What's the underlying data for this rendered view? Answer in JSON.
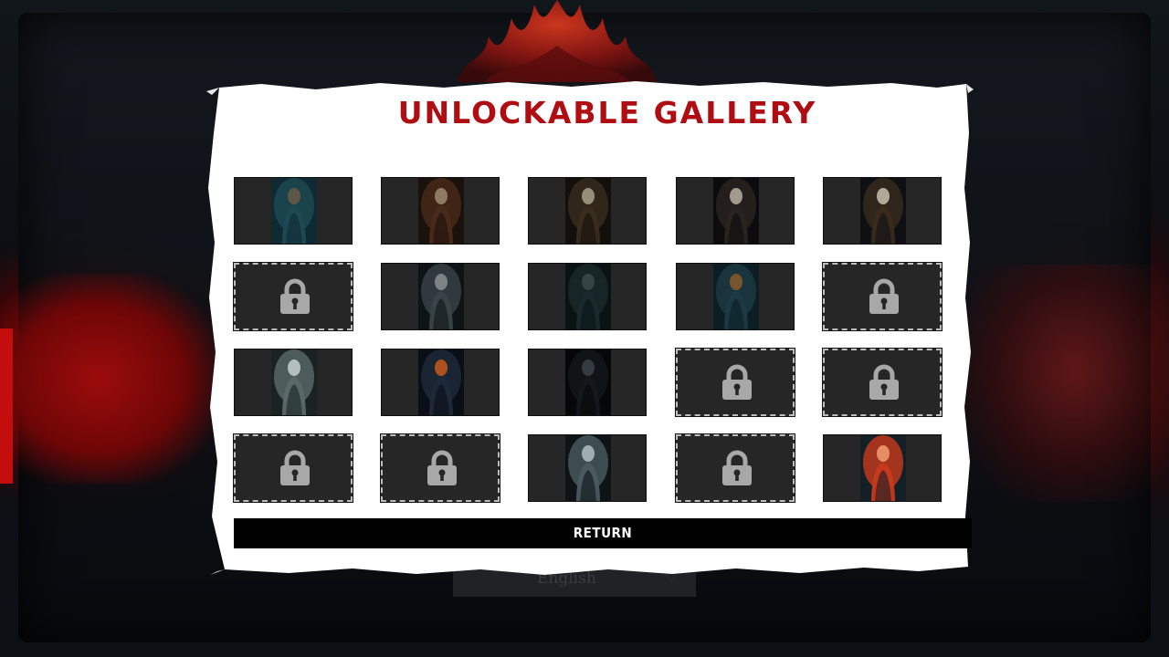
{
  "title": "UNLOCKABLE GALLERY",
  "return_label": "RETURN",
  "language": {
    "selected": "English",
    "chevron_icon": "chevron-down-icon"
  },
  "colors": {
    "title": "#b00d12",
    "tile_bg": "#262626",
    "return_bg": "#000000",
    "paper": "#ffffff"
  },
  "gallery": {
    "rows": 4,
    "columns": 5,
    "tiles": [
      {
        "state": "unlocked",
        "art": "masked-killer-teal"
      },
      {
        "state": "unlocked",
        "art": "masked-killer-rust"
      },
      {
        "state": "unlocked",
        "art": "masked-killer-brown"
      },
      {
        "state": "unlocked",
        "art": "masked-killer-dark"
      },
      {
        "state": "unlocked",
        "art": "masked-killer-bat"
      },
      {
        "state": "locked",
        "art": "lock-icon"
      },
      {
        "state": "unlocked",
        "art": "antlered-creature"
      },
      {
        "state": "unlocked",
        "art": "forest-figure"
      },
      {
        "state": "unlocked",
        "art": "pumpkin-creature"
      },
      {
        "state": "locked",
        "art": "lock-icon"
      },
      {
        "state": "unlocked",
        "art": "pale-forest-wraith"
      },
      {
        "state": "unlocked",
        "art": "ember-creature"
      },
      {
        "state": "unlocked",
        "art": "dark-shadow"
      },
      {
        "state": "locked",
        "art": "lock-icon"
      },
      {
        "state": "locked",
        "art": "lock-icon"
      },
      {
        "state": "locked",
        "art": "lock-icon"
      },
      {
        "state": "locked",
        "art": "lock-icon"
      },
      {
        "state": "unlocked",
        "art": "figure-in-mist"
      },
      {
        "state": "locked",
        "art": "lock-icon"
      },
      {
        "state": "unlocked",
        "art": "redhead-woman"
      }
    ]
  }
}
